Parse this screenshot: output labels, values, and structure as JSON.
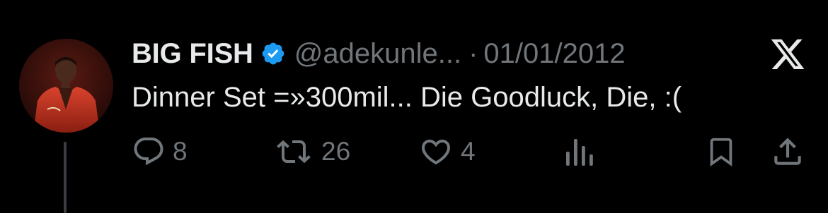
{
  "tweet": {
    "display_name": "BIG FISH",
    "handle": "@adekunle...",
    "separator": "·",
    "date": "01/01/2012",
    "text": "Dinner Set =»300mil... Die Goodluck, Die, :("
  },
  "actions": {
    "replies": "8",
    "retweets": "26",
    "likes": "4"
  },
  "colors": {
    "background": "#000000",
    "text_primary": "#e7e9ea",
    "text_secondary": "#71767b",
    "verified": "#1d9bf0"
  },
  "icons": {
    "verified": "verified-badge-icon",
    "platform": "x-logo-icon",
    "reply": "reply-icon",
    "retweet": "retweet-icon",
    "like": "heart-icon",
    "views": "views-chart-icon",
    "bookmark": "bookmark-icon",
    "share": "share-icon"
  }
}
